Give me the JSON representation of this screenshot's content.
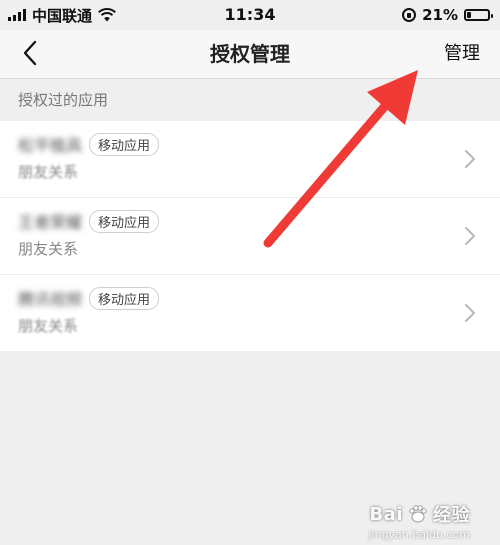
{
  "status_bar": {
    "carrier": "中国联通",
    "time": "11:34",
    "battery_percent": "21%",
    "battery_level": 0.21,
    "icons": [
      "signal-icon",
      "wifi-icon",
      "rotation-lock-icon",
      "battery-icon"
    ]
  },
  "nav": {
    "title": "授权管理",
    "manage_label": "管理",
    "back_icon": "chevron-left-icon"
  },
  "section": {
    "header": "授权过的应用"
  },
  "apps": [
    {
      "name": "松平植具",
      "tag": "移动应用",
      "permission": "朋友关系"
    },
    {
      "name": "王者荣耀",
      "tag": "移动应用",
      "permission": "朋友关系"
    },
    {
      "name": "腾讯视频",
      "tag": "移动应用",
      "permission": "朋友关系"
    }
  ],
  "annotation": {
    "arrow_color": "#f03a36"
  },
  "watermark": {
    "brand": "Bai",
    "brand_suffix": "经验",
    "url": "jingyan.baidu.com"
  }
}
